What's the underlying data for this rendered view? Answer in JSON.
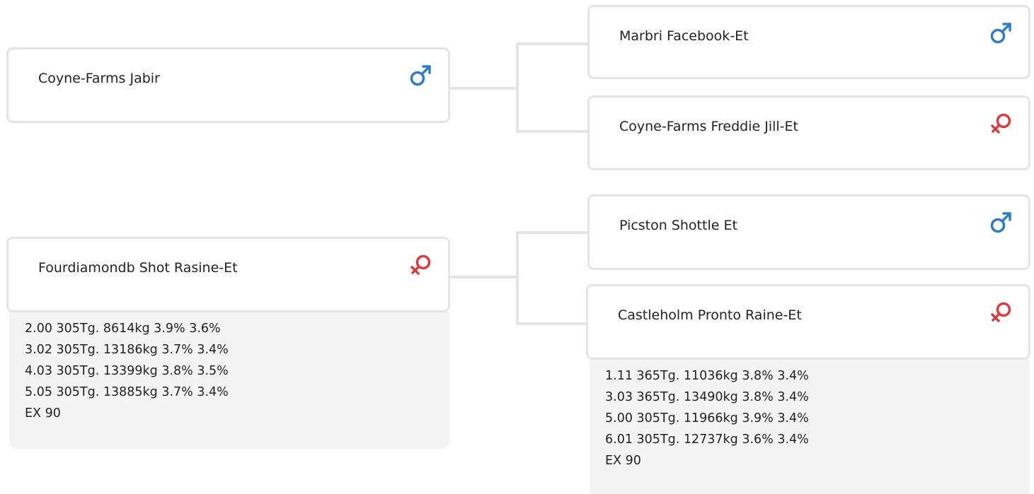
{
  "sire": {
    "name": "Coyne-Farms Jabir",
    "sex_icon": "male-symbol",
    "color": "#2f7cc3"
  },
  "dam": {
    "name": "Fourdiamondb Shot Rasine-Et",
    "sex_icon": "female-symbol",
    "color": "#d33f3f",
    "records": [
      "2.00 305Tg. 8614kg 3.9% 3.6%",
      "3.02 305Tg. 13186kg 3.7% 3.4%",
      "4.03 305Tg. 13399kg 3.8% 3.5%",
      "5.05 305Tg. 13885kg 3.7% 3.4%",
      "EX 90"
    ]
  },
  "sire_sire": {
    "name": "Marbri Facebook-Et",
    "sex_icon": "male-symbol"
  },
  "sire_dam": {
    "name": "Coyne-Farms Freddie Jill-Et",
    "sex_icon": "female-symbol"
  },
  "dam_sire": {
    "name": "Picston Shottle Et",
    "sex_icon": "male-symbol"
  },
  "dam_dam": {
    "name": "Castleholm Pronto Raine-Et",
    "sex_icon": "female-symbol",
    "records": [
      "1.11 365Tg. 11036kg 3.8% 3.4%",
      "3.03 365Tg. 13490kg 3.8% 3.4%",
      "5.00 305Tg. 11966kg 3.9% 3.4%",
      "6.01 305Tg. 12737kg 3.6% 3.4%",
      "EX 90"
    ]
  }
}
